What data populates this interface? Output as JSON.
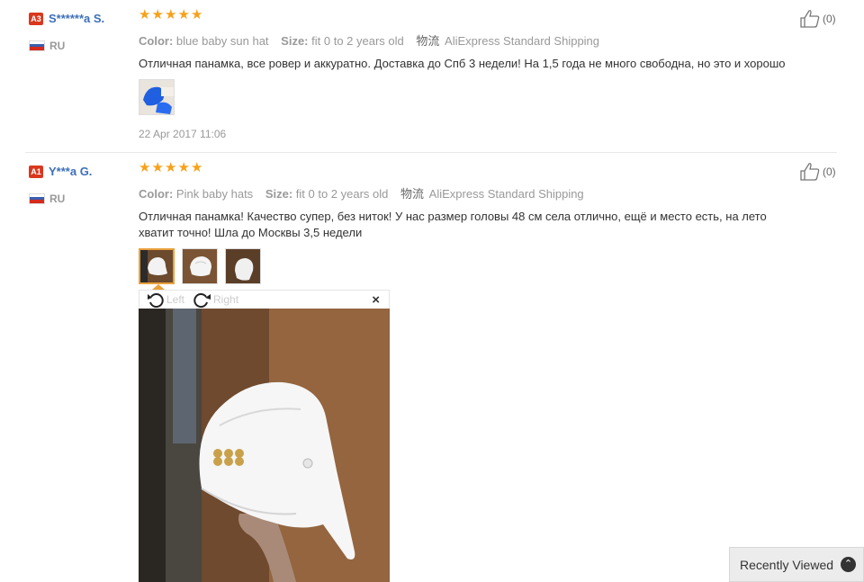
{
  "reviews": [
    {
      "level": "A3",
      "level_color": "#d9381e",
      "user": "S******a S.",
      "country": "RU",
      "stars": 5,
      "color_label": "Color:",
      "color_value": "blue baby sun hat",
      "size_label": "Size:",
      "size_value": "fit 0 to 2 years old",
      "shipping_icon": "物流",
      "shipping": "AliExpress Standard Shipping",
      "text": "Отличная панамка, все ровер и аккуратно. Доставка до Спб 3 недели! На 1,5 года не много свободна, но это и хорошо",
      "likes": "(0)",
      "date": "22 Apr 2017 11:06"
    },
    {
      "level": "A1",
      "level_color": "#d9381e",
      "user": "Y***a G.",
      "country": "RU",
      "stars": 5,
      "color_label": "Color:",
      "color_value": "Pink baby hats",
      "size_label": "Size:",
      "size_value": "fit 0 to 2 years old",
      "shipping_icon": "物流",
      "shipping": "AliExpress Standard Shipping",
      "text": "Отличная панамка! Качество супер, без ниток! У нас размер головы 48 см села отлично, ещё и место есть, на лето хватит точно! Шла до Москвы 3,5 недели",
      "likes": "(0)"
    }
  ],
  "viewer": {
    "rotate_left": "Left",
    "rotate_right": "Right",
    "close": "×"
  },
  "recently_viewed": {
    "label": "Recently Viewed",
    "icon": "chevron-up-icon"
  },
  "colors": {
    "star": "#f7a11a",
    "username": "#3c6fba",
    "active_thumb": "#e8a13b"
  }
}
